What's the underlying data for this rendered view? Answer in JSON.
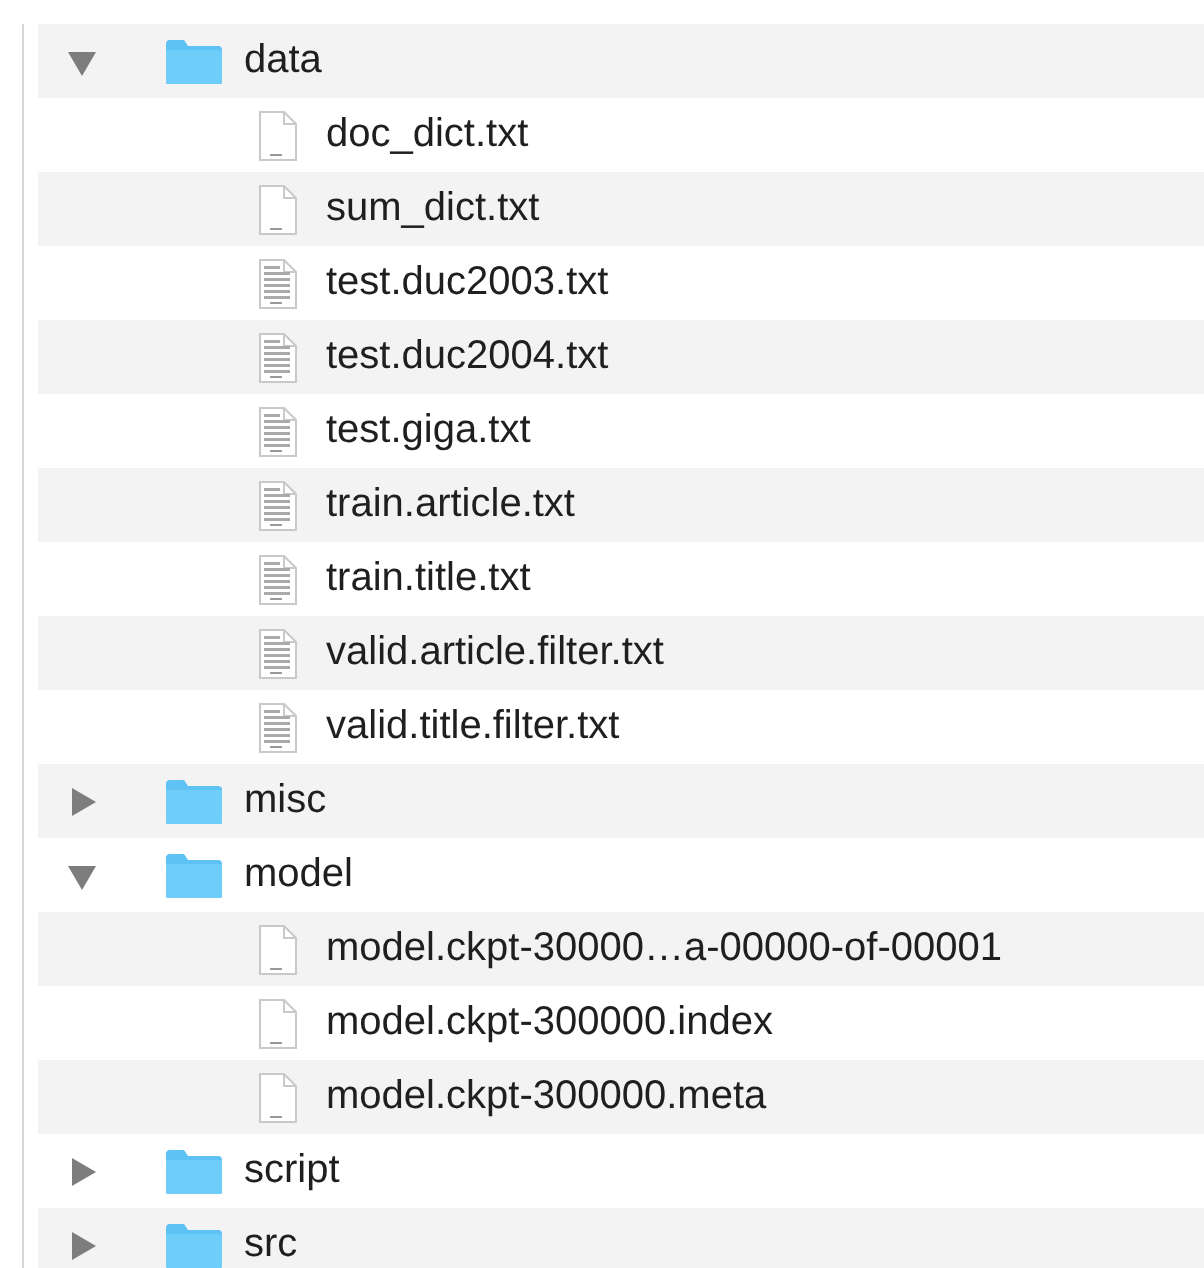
{
  "tree": [
    {
      "name": "data",
      "kind": "folder",
      "expanded": true,
      "children": [
        {
          "name": "doc_dict.txt",
          "kind": "blank"
        },
        {
          "name": "sum_dict.txt",
          "kind": "blank"
        },
        {
          "name": "test.duc2003.txt",
          "kind": "text"
        },
        {
          "name": "test.duc2004.txt",
          "kind": "text"
        },
        {
          "name": "test.giga.txt",
          "kind": "text"
        },
        {
          "name": "train.article.txt",
          "kind": "text"
        },
        {
          "name": "train.title.txt",
          "kind": "text"
        },
        {
          "name": "valid.article.filter.txt",
          "kind": "text"
        },
        {
          "name": "valid.title.filter.txt",
          "kind": "text"
        }
      ]
    },
    {
      "name": "misc",
      "kind": "folder",
      "expanded": false
    },
    {
      "name": "model",
      "kind": "folder",
      "expanded": true,
      "children": [
        {
          "name": "model.ckpt-30000…a-00000-of-00001",
          "kind": "blank"
        },
        {
          "name": "model.ckpt-300000.index",
          "kind": "blank"
        },
        {
          "name": "model.ckpt-300000.meta",
          "kind": "blank"
        }
      ]
    },
    {
      "name": "script",
      "kind": "folder",
      "expanded": false
    },
    {
      "name": "src",
      "kind": "folder",
      "expanded": false
    }
  ]
}
